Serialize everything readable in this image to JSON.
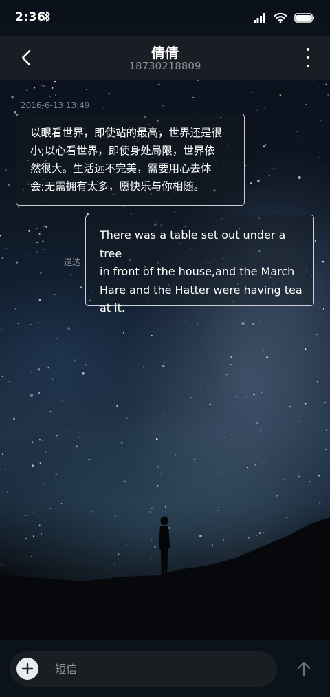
{
  "status_bar": {
    "time": "2:36",
    "bluetooth_icon": "bluetooth-icon",
    "signal_icon": "cell-signal-icon",
    "wifi_icon": "wifi-icon",
    "battery_icon": "battery-icon"
  },
  "header": {
    "back_icon": "chevron-left-icon",
    "contact_name": "倩倩",
    "contact_number": "18730218809",
    "more_icon": "more-vertical-icon"
  },
  "conversation": {
    "timestamp": "2016-6-13 13:49",
    "messages": [
      {
        "direction": "incoming",
        "lines": [
          "以眼看世界，即使站的最高，世界还是很",
          "小;以心看世界，即使身处局限，世界依",
          "然很大。生活远不完美，需要用心去体",
          "会;无需拥有太多，愿快乐与你相随。"
        ]
      },
      {
        "direction": "outgoing",
        "status": "送达",
        "lines": [
          "There was a table set out under a tree",
          "in front of the house,and the March",
          "Hare and the Hatter were having tea",
          "at it."
        ]
      }
    ]
  },
  "composer": {
    "add_icon": "plus-icon",
    "placeholder": "短信",
    "value": "",
    "send_icon": "arrow-up-icon"
  },
  "colors": {
    "bubble_border": "#ebf0f5",
    "header_bg": "#1c2026",
    "muted_text": "#8e939b"
  }
}
